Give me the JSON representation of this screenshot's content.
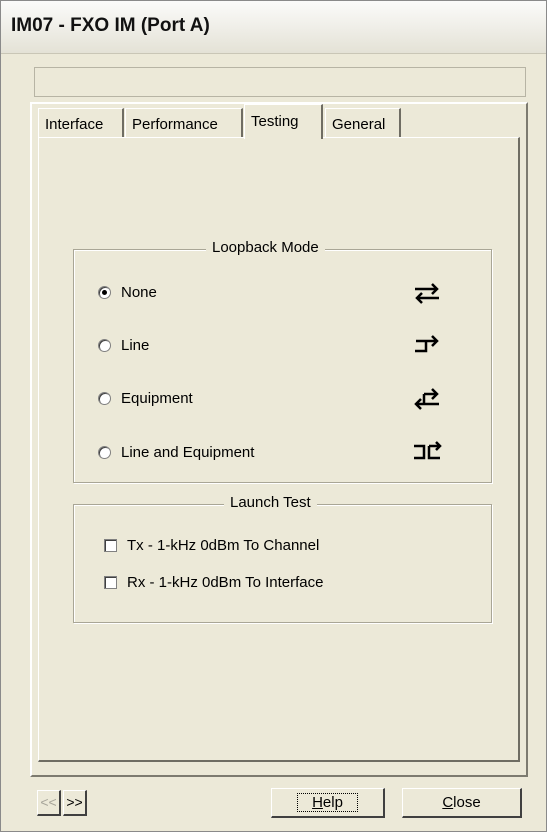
{
  "window": {
    "title": "IM07 - FXO IM (Port A)",
    "status_text": ""
  },
  "tabs": [
    {
      "label": "Interface",
      "active": false
    },
    {
      "label": "Performance",
      "active": false
    },
    {
      "label": "Testing",
      "active": true
    },
    {
      "label": "General",
      "active": false
    }
  ],
  "loopback": {
    "legend": "Loopback Mode",
    "options": [
      {
        "label": "None",
        "selected": true,
        "icon": "loopback-none-icon"
      },
      {
        "label": "Line",
        "selected": false,
        "icon": "loopback-line-icon"
      },
      {
        "label": "Equipment",
        "selected": false,
        "icon": "loopback-equipment-icon"
      },
      {
        "label": "Line and Equipment",
        "selected": false,
        "icon": "loopback-line-equipment-icon"
      }
    ]
  },
  "launch_test": {
    "legend": "Launch Test",
    "options": [
      {
        "label": "Tx - 1-kHz 0dBm To Channel",
        "checked": false
      },
      {
        "label": "Rx - 1-kHz 0dBm To Interface",
        "checked": false
      }
    ]
  },
  "footer": {
    "prev_label": "<<",
    "next_label": ">>",
    "help_accel": "H",
    "help_rest": "elp",
    "close_accel": "C",
    "close_rest": "lose"
  }
}
